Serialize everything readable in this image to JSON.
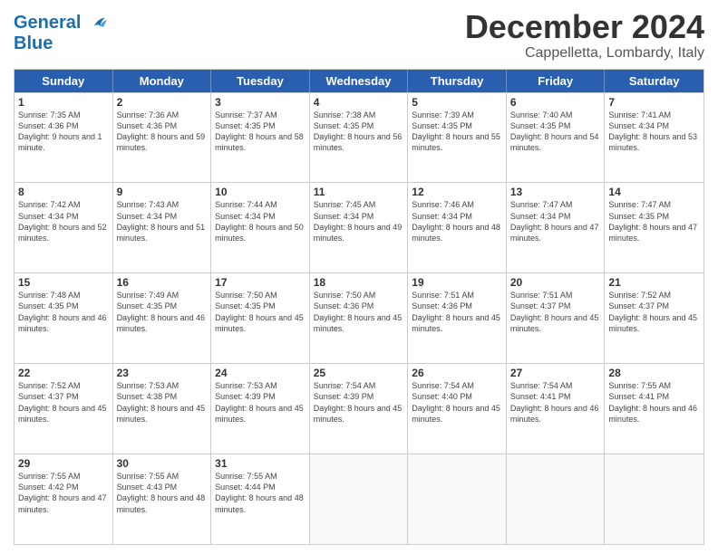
{
  "header": {
    "logo_line1": "General",
    "logo_line2": "Blue",
    "month": "December 2024",
    "location": "Cappelletta, Lombardy, Italy"
  },
  "weekdays": [
    "Sunday",
    "Monday",
    "Tuesday",
    "Wednesday",
    "Thursday",
    "Friday",
    "Saturday"
  ],
  "weeks": [
    [
      {
        "day": "1",
        "sunrise": "7:35 AM",
        "sunset": "4:36 PM",
        "daylight": "9 hours and 1 minute."
      },
      {
        "day": "2",
        "sunrise": "7:36 AM",
        "sunset": "4:36 PM",
        "daylight": "8 hours and 59 minutes."
      },
      {
        "day": "3",
        "sunrise": "7:37 AM",
        "sunset": "4:35 PM",
        "daylight": "8 hours and 58 minutes."
      },
      {
        "day": "4",
        "sunrise": "7:38 AM",
        "sunset": "4:35 PM",
        "daylight": "8 hours and 56 minutes."
      },
      {
        "day": "5",
        "sunrise": "7:39 AM",
        "sunset": "4:35 PM",
        "daylight": "8 hours and 55 minutes."
      },
      {
        "day": "6",
        "sunrise": "7:40 AM",
        "sunset": "4:35 PM",
        "daylight": "8 hours and 54 minutes."
      },
      {
        "day": "7",
        "sunrise": "7:41 AM",
        "sunset": "4:34 PM",
        "daylight": "8 hours and 53 minutes."
      }
    ],
    [
      {
        "day": "8",
        "sunrise": "7:42 AM",
        "sunset": "4:34 PM",
        "daylight": "8 hours and 52 minutes."
      },
      {
        "day": "9",
        "sunrise": "7:43 AM",
        "sunset": "4:34 PM",
        "daylight": "8 hours and 51 minutes."
      },
      {
        "day": "10",
        "sunrise": "7:44 AM",
        "sunset": "4:34 PM",
        "daylight": "8 hours and 50 minutes."
      },
      {
        "day": "11",
        "sunrise": "7:45 AM",
        "sunset": "4:34 PM",
        "daylight": "8 hours and 49 minutes."
      },
      {
        "day": "12",
        "sunrise": "7:46 AM",
        "sunset": "4:34 PM",
        "daylight": "8 hours and 48 minutes."
      },
      {
        "day": "13",
        "sunrise": "7:47 AM",
        "sunset": "4:34 PM",
        "daylight": "8 hours and 47 minutes."
      },
      {
        "day": "14",
        "sunrise": "7:47 AM",
        "sunset": "4:35 PM",
        "daylight": "8 hours and 47 minutes."
      }
    ],
    [
      {
        "day": "15",
        "sunrise": "7:48 AM",
        "sunset": "4:35 PM",
        "daylight": "8 hours and 46 minutes."
      },
      {
        "day": "16",
        "sunrise": "7:49 AM",
        "sunset": "4:35 PM",
        "daylight": "8 hours and 46 minutes."
      },
      {
        "day": "17",
        "sunrise": "7:50 AM",
        "sunset": "4:35 PM",
        "daylight": "8 hours and 45 minutes."
      },
      {
        "day": "18",
        "sunrise": "7:50 AM",
        "sunset": "4:36 PM",
        "daylight": "8 hours and 45 minutes."
      },
      {
        "day": "19",
        "sunrise": "7:51 AM",
        "sunset": "4:36 PM",
        "daylight": "8 hours and 45 minutes."
      },
      {
        "day": "20",
        "sunrise": "7:51 AM",
        "sunset": "4:37 PM",
        "daylight": "8 hours and 45 minutes."
      },
      {
        "day": "21",
        "sunrise": "7:52 AM",
        "sunset": "4:37 PM",
        "daylight": "8 hours and 45 minutes."
      }
    ],
    [
      {
        "day": "22",
        "sunrise": "7:52 AM",
        "sunset": "4:37 PM",
        "daylight": "8 hours and 45 minutes."
      },
      {
        "day": "23",
        "sunrise": "7:53 AM",
        "sunset": "4:38 PM",
        "daylight": "8 hours and 45 minutes."
      },
      {
        "day": "24",
        "sunrise": "7:53 AM",
        "sunset": "4:39 PM",
        "daylight": "8 hours and 45 minutes."
      },
      {
        "day": "25",
        "sunrise": "7:54 AM",
        "sunset": "4:39 PM",
        "daylight": "8 hours and 45 minutes."
      },
      {
        "day": "26",
        "sunrise": "7:54 AM",
        "sunset": "4:40 PM",
        "daylight": "8 hours and 45 minutes."
      },
      {
        "day": "27",
        "sunrise": "7:54 AM",
        "sunset": "4:41 PM",
        "daylight": "8 hours and 46 minutes."
      },
      {
        "day": "28",
        "sunrise": "7:55 AM",
        "sunset": "4:41 PM",
        "daylight": "8 hours and 46 minutes."
      }
    ],
    [
      {
        "day": "29",
        "sunrise": "7:55 AM",
        "sunset": "4:42 PM",
        "daylight": "8 hours and 47 minutes."
      },
      {
        "day": "30",
        "sunrise": "7:55 AM",
        "sunset": "4:43 PM",
        "daylight": "8 hours and 48 minutes."
      },
      {
        "day": "31",
        "sunrise": "7:55 AM",
        "sunset": "4:44 PM",
        "daylight": "8 hours and 48 minutes."
      },
      null,
      null,
      null,
      null
    ]
  ]
}
